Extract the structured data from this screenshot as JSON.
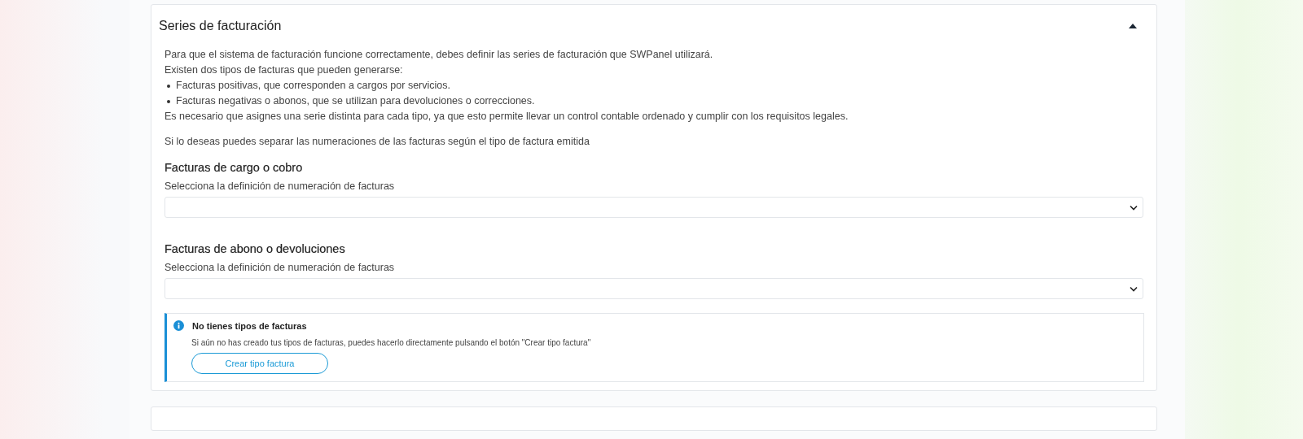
{
  "panel": {
    "title": "Series de facturación",
    "expanded": true,
    "intro": [
      "Para que el sistema de facturación funcione correctamente, debes definir las series de facturación que SWPanel utilizará.",
      "Existen dos tipos de facturas que pueden generarse:"
    ],
    "bullets": [
      "Facturas positivas, que corresponden a cargos por servicios.",
      "Facturas negativas o abonos, que se utilizan para devoluciones o correcciones."
    ],
    "outro": "Es necesario que asignes una serie distinta para cada tipo, ya que esto permite llevar un control contable ordenado y cumplir con los requisitos legales.",
    "note": "Si lo deseas puedes separar las numeraciones de las facturas según el tipo de factura emitida",
    "sections": [
      {
        "heading": "Facturas de cargo o cobro",
        "label": "Selecciona la definición de numeración de facturas"
      },
      {
        "heading": "Facturas de abono o devoluciones",
        "label": "Selecciona la definición de numeración de facturas"
      }
    ],
    "alert": {
      "title": "No tienes tipos de facturas",
      "text": "Si aún no has creado tus tipos de facturas, puedes hacerlo directamente pulsando el botón \"Crear tipo factura\"",
      "button": "Crear tipo factura"
    }
  }
}
